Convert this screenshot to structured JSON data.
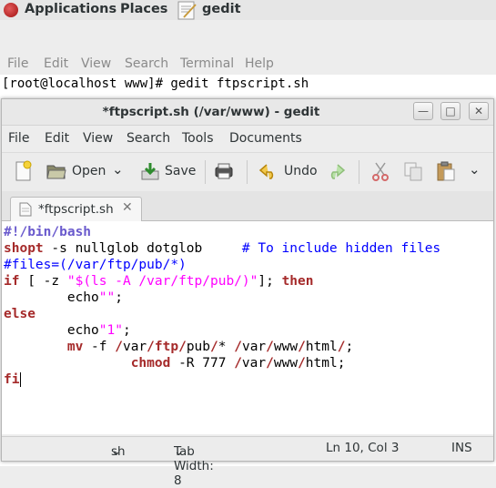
{
  "topbar": {
    "applications_label": "Applications",
    "places_label": "Places",
    "app_label": "gedit"
  },
  "terminal": {
    "menu": [
      "File",
      "Edit",
      "View",
      "Search",
      "Terminal",
      "Help"
    ],
    "prompt_line": "[root@localhost www]# gedit ftpscript.sh"
  },
  "gedit": {
    "title": "*ftpscript.sh (/var/www) - gedit",
    "menu": [
      "File",
      "Edit",
      "View",
      "Search",
      "Tools",
      "Documents"
    ],
    "toolbar": {
      "open_label": "Open",
      "save_label": "Save",
      "undo_label": "Undo"
    },
    "tab_label": "*ftpscript.sh",
    "code_lines": [
      "#!/bin/bash",
      "shopt -s nullglob dotglob     # To include hidden files",
      "#files=(/var/ftp/pub/*)",
      "if [ -z \"$(ls -A /var/ftp/pub/)\"]; then",
      "        echo\"\";",
      "else",
      "        echo\"1\";",
      "        mv -f /var/ftp/pub/* /var/www/html/;",
      "                chmod -R 777 /var/www/html;",
      "fi"
    ],
    "status": {
      "language": "sh",
      "tab_width": "Tab Width:  8",
      "position": "Ln 10, Col 3",
      "mode": "INS"
    }
  }
}
